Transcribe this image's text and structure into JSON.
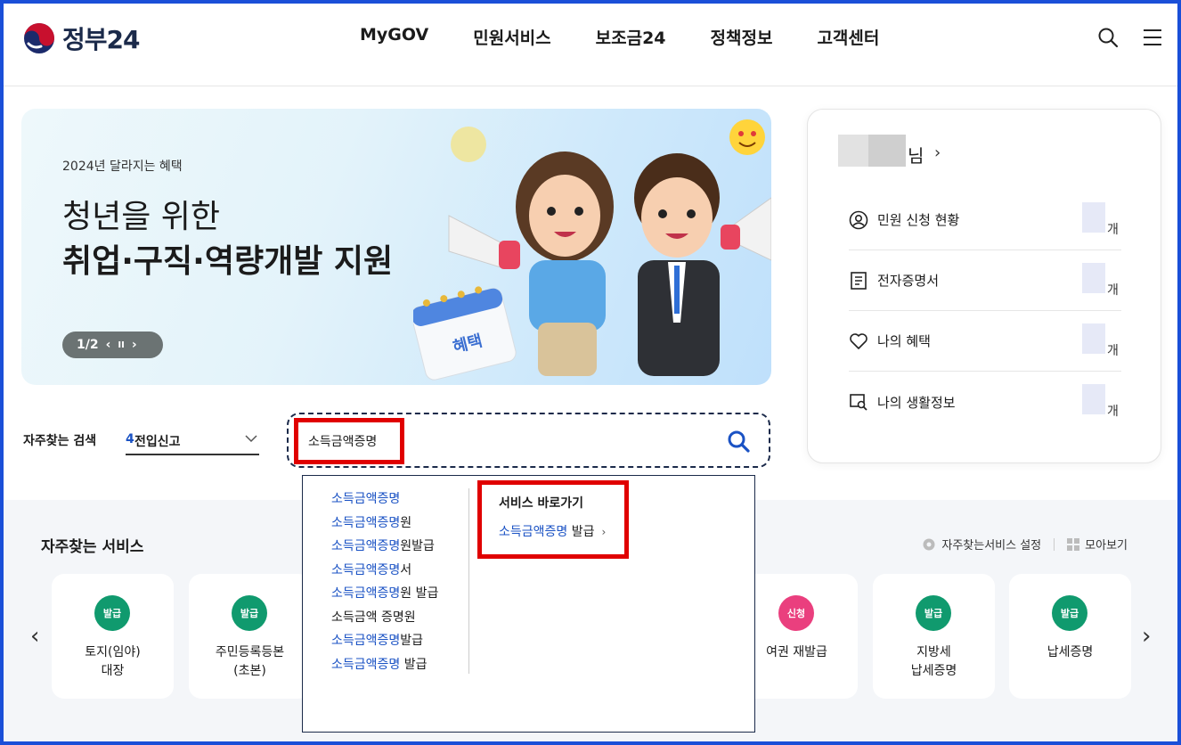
{
  "header": {
    "logo_text": "정부24",
    "nav": [
      "MyGOV",
      "민원서비스",
      "보조금24",
      "정책정보",
      "고객센터"
    ],
    "icons": [
      "search-icon",
      "menu-icon"
    ]
  },
  "banner": {
    "subtitle": "2024년 달라지는 혜택",
    "title_line1": "청년을 위한",
    "title_line2": "취업·구직·역량개발 지원",
    "pager": "1/2",
    "pager_prev": "‹",
    "pager_pause": "II",
    "pager_next": "›",
    "calendar_label": "혜택"
  },
  "user_panel": {
    "suffix": "님",
    "arrow": "›",
    "rows": [
      {
        "label": "민원 신청 현황",
        "unit": "개",
        "icon": "person-icon"
      },
      {
        "label": "전자증명서",
        "unit": "개",
        "icon": "document-icon"
      },
      {
        "label": "나의 혜택",
        "unit": "개",
        "icon": "heart-icon"
      },
      {
        "label": "나의 생활정보",
        "unit": "개",
        "icon": "magnify-doc-icon"
      }
    ]
  },
  "search": {
    "fav_label": "자주찾는 검색",
    "fav_num": "4",
    "fav_value": "전입신고",
    "query": "소득금액증명"
  },
  "autocomplete": {
    "suggestions": [
      {
        "match": "소득금액증명",
        "rest": ""
      },
      {
        "match": "소득금액증명",
        "rest": "원"
      },
      {
        "match": "소득금액증명",
        "rest": "원발급"
      },
      {
        "match": "소득금액증명",
        "rest": "서"
      },
      {
        "match": "소득금액증명",
        "rest": "원 발급"
      },
      {
        "match": "",
        "rest": "소득금액 증명원"
      },
      {
        "match": "소득금액증명",
        "rest": "발급"
      },
      {
        "match": "소득금액증명",
        "rest": " 발급"
      }
    ],
    "quick_title": "서비스 바로가기",
    "quick_match": "소득금액증명",
    "quick_rest": " 발급",
    "quick_arrow": "›"
  },
  "frequent": {
    "title": "자주찾는 서비스",
    "setting_label": "자주찾는서비스 설정",
    "viewall_label": "모아보기",
    "prev": "‹",
    "next": "›",
    "cards": [
      {
        "badge": "발급",
        "color": "#109a6e",
        "line1": "토지(임야)",
        "line2": "대장"
      },
      {
        "badge": "발급",
        "color": "#109a6e",
        "line1": "주민등록등본",
        "line2": "(초본)"
      },
      {
        "badge": "신청",
        "color": "#ea3f7e",
        "line1": "여권 재발급",
        "line2": ""
      },
      {
        "badge": "발급",
        "color": "#109a6e",
        "line1": "지방세",
        "line2": "납세증명"
      },
      {
        "badge": "발급",
        "color": "#109a6e",
        "line1": "납세증명",
        "line2": ""
      }
    ]
  },
  "colors": {
    "accent_blue": "#1a52c4",
    "highlight_red": "#e00000",
    "badge_green": "#109a6e",
    "badge_pink": "#ea3f7e"
  }
}
